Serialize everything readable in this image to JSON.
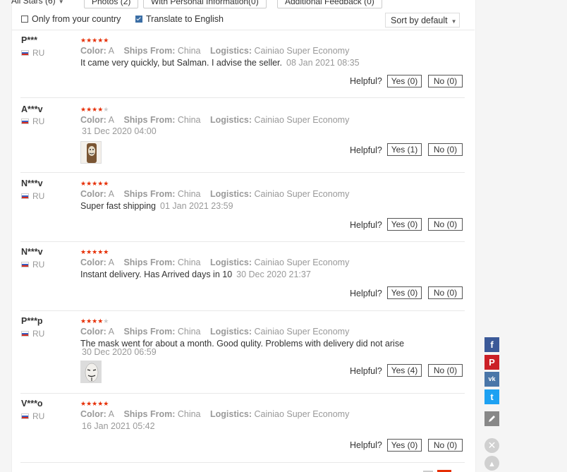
{
  "filters": {
    "all_stars": "All Stars (6)",
    "photos": "Photos (2)",
    "personal": "With Personal Information(0)",
    "additional": "Additional Feedback (0)",
    "only_country": "Only from your country",
    "translate": "Translate to English",
    "sort": "Sort by default"
  },
  "labels": {
    "color": "Color:",
    "ships": "Ships From:",
    "logistics": "Logistics:",
    "helpful": "Helpful?"
  },
  "reviews": [
    {
      "user": "P***",
      "country": "RU",
      "color": "A",
      "ships": "China",
      "logistics": "Cainiao Super Economy",
      "text": "It came very quickly, but Salman. I advise the seller.",
      "date": "08 Jan 2021 08:35",
      "yes": "Yes (0)",
      "no": "No (0)"
    },
    {
      "user": "A***v",
      "country": "RU",
      "color": "A",
      "ships": "China",
      "logistics": "Cainiao Super Economy",
      "text": "",
      "date": "31 Dec 2020 04:00",
      "yes": "Yes (1)",
      "no": "No (0)"
    },
    {
      "user": "N***v",
      "country": "RU",
      "color": "A",
      "ships": "China",
      "logistics": "Cainiao Super Economy",
      "text": "Super fast shipping",
      "date": "01 Jan 2021 23:59",
      "yes": "Yes (0)",
      "no": "No (0)"
    },
    {
      "user": "N***v",
      "country": "RU",
      "color": "A",
      "ships": "China",
      "logistics": "Cainiao Super Economy",
      "text": "Instant delivery. Has Arrived days in 10",
      "date": "30 Dec 2020 21:37",
      "yes": "Yes (0)",
      "no": "No (0)"
    },
    {
      "user": "P***p",
      "country": "RU",
      "color": "A",
      "ships": "China",
      "logistics": "Cainiao Super Economy",
      "text": "The mask went for about a month. Good qulity. Problems with delivery did not arise",
      "date": "30 Dec 2020 06:59",
      "yes": "Yes (4)",
      "no": "No (0)"
    },
    {
      "user": "V***o",
      "country": "RU",
      "color": "A",
      "ships": "China",
      "logistics": "Cainiao Super Economy",
      "text": "",
      "date": "16 Jan 2021 05:42",
      "yes": "Yes (0)",
      "no": "No (0)"
    }
  ],
  "social": {
    "facebook": "f",
    "pinterest": "P",
    "vk": "vk",
    "twitter": "t"
  },
  "colors": {
    "star": "#e62e04",
    "facebook": "#3b5998",
    "pinterest": "#cb2027",
    "vk": "#4a76a8",
    "twitter": "#1da1f2",
    "edit": "#888888"
  }
}
